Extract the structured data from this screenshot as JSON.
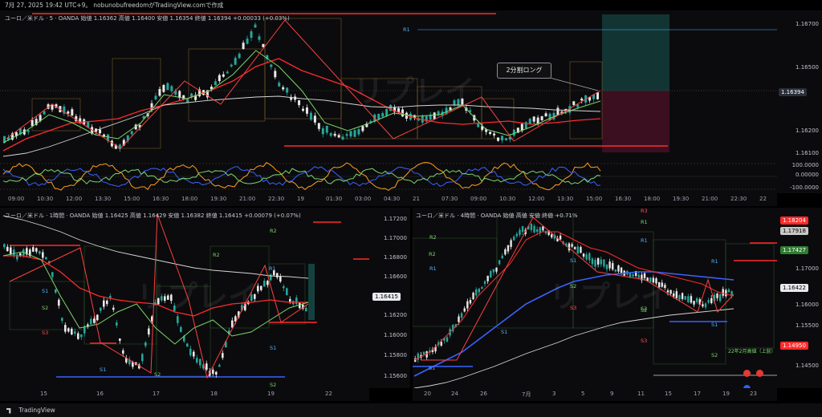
{
  "header": {
    "text": "7月 27, 2025 19:42 UTC+9。 nobunobufreedomがTradingView.comで作成"
  },
  "main": {
    "legend": "ユーロ／米ドル · 5 · OANDA 始値 1.16362 高値 1.16400 安値 1.16354 終値 1.16394 +0.00033 (+0.03%)",
    "price_ticks": [
      "1.16700",
      "1.16500",
      "1.16394",
      "1.16200",
      "1.16100"
    ],
    "current_price": "1.16394",
    "r1_label": "R1",
    "callout": "2分割ロング",
    "watermark": "リプレイ",
    "osc_ticks": [
      "100.0000",
      "0.00000",
      "-100.0000"
    ],
    "time_labels": [
      "09:00",
      "10:30",
      "12:00",
      "13:30",
      "15:00",
      "16:30",
      "18:00",
      "19:30",
      "21:00",
      "22:30",
      "19",
      "01:30",
      "03:00",
      "04:30",
      "21",
      "07:30",
      "09:00",
      "10:30",
      "12:00",
      "13:30",
      "15:00",
      "16:30",
      "18:00",
      "19:30",
      "21:00",
      "22:30",
      "22"
    ]
  },
  "h1": {
    "legend": "ユーロ／米ドル · 1時間 · OANDA 始値 1.16425 高値 1.16429 安値 1.16382 終値 1.16415 +0.00079 (+0.07%)",
    "price_ticks": [
      "1.17200",
      "1.17000",
      "1.16800",
      "1.16600",
      "1.16415",
      "1.16200",
      "1.16000",
      "1.15800",
      "1.15600"
    ],
    "current_price": "1.16415",
    "levels": [
      "R2",
      "R2",
      "R1",
      "S1",
      "S2",
      "S3",
      "S1",
      "S2",
      "S1",
      "S2"
    ],
    "time_labels": [
      "15",
      "16",
      "17",
      "18",
      "19",
      "22"
    ]
  },
  "h4": {
    "legend": "ユーロ／米ドル · 4時間 · OANDA 始値 高値 安値 終値 +0.71%",
    "price_ticks": [
      "1.18204",
      "1.17918",
      "1.17427",
      "1.17000",
      "1.16422",
      "1.16000",
      "1.15500",
      "1.14950",
      "1.14500"
    ],
    "current_price": "1.16422",
    "tag_red_top": "1.18204",
    "tag_gray": "1.17918",
    "tag_green": "1.17427",
    "tag_red_bottom": "1.14950",
    "levels": [
      "R2",
      "R1",
      "S1",
      "S2",
      "R3",
      "R2",
      "R1",
      "S1",
      "S2",
      "S3",
      "R1",
      "S1",
      "S2",
      "R1",
      "S1",
      "S2",
      "S3"
    ],
    "annotation": "22年2月高値（上髭）",
    "time_labels": [
      "20",
      "24",
      "26",
      "7月",
      "3",
      "5",
      "9",
      "11",
      "15",
      "17",
      "19",
      "23"
    ]
  },
  "footer": {
    "brand": "TradingView"
  },
  "colors": {
    "red": "#ff2a2a",
    "green": "#7cd66b",
    "blue": "#3a62ff",
    "orange": "#ff9f1a",
    "white_ma": "#d6d6d6"
  }
}
